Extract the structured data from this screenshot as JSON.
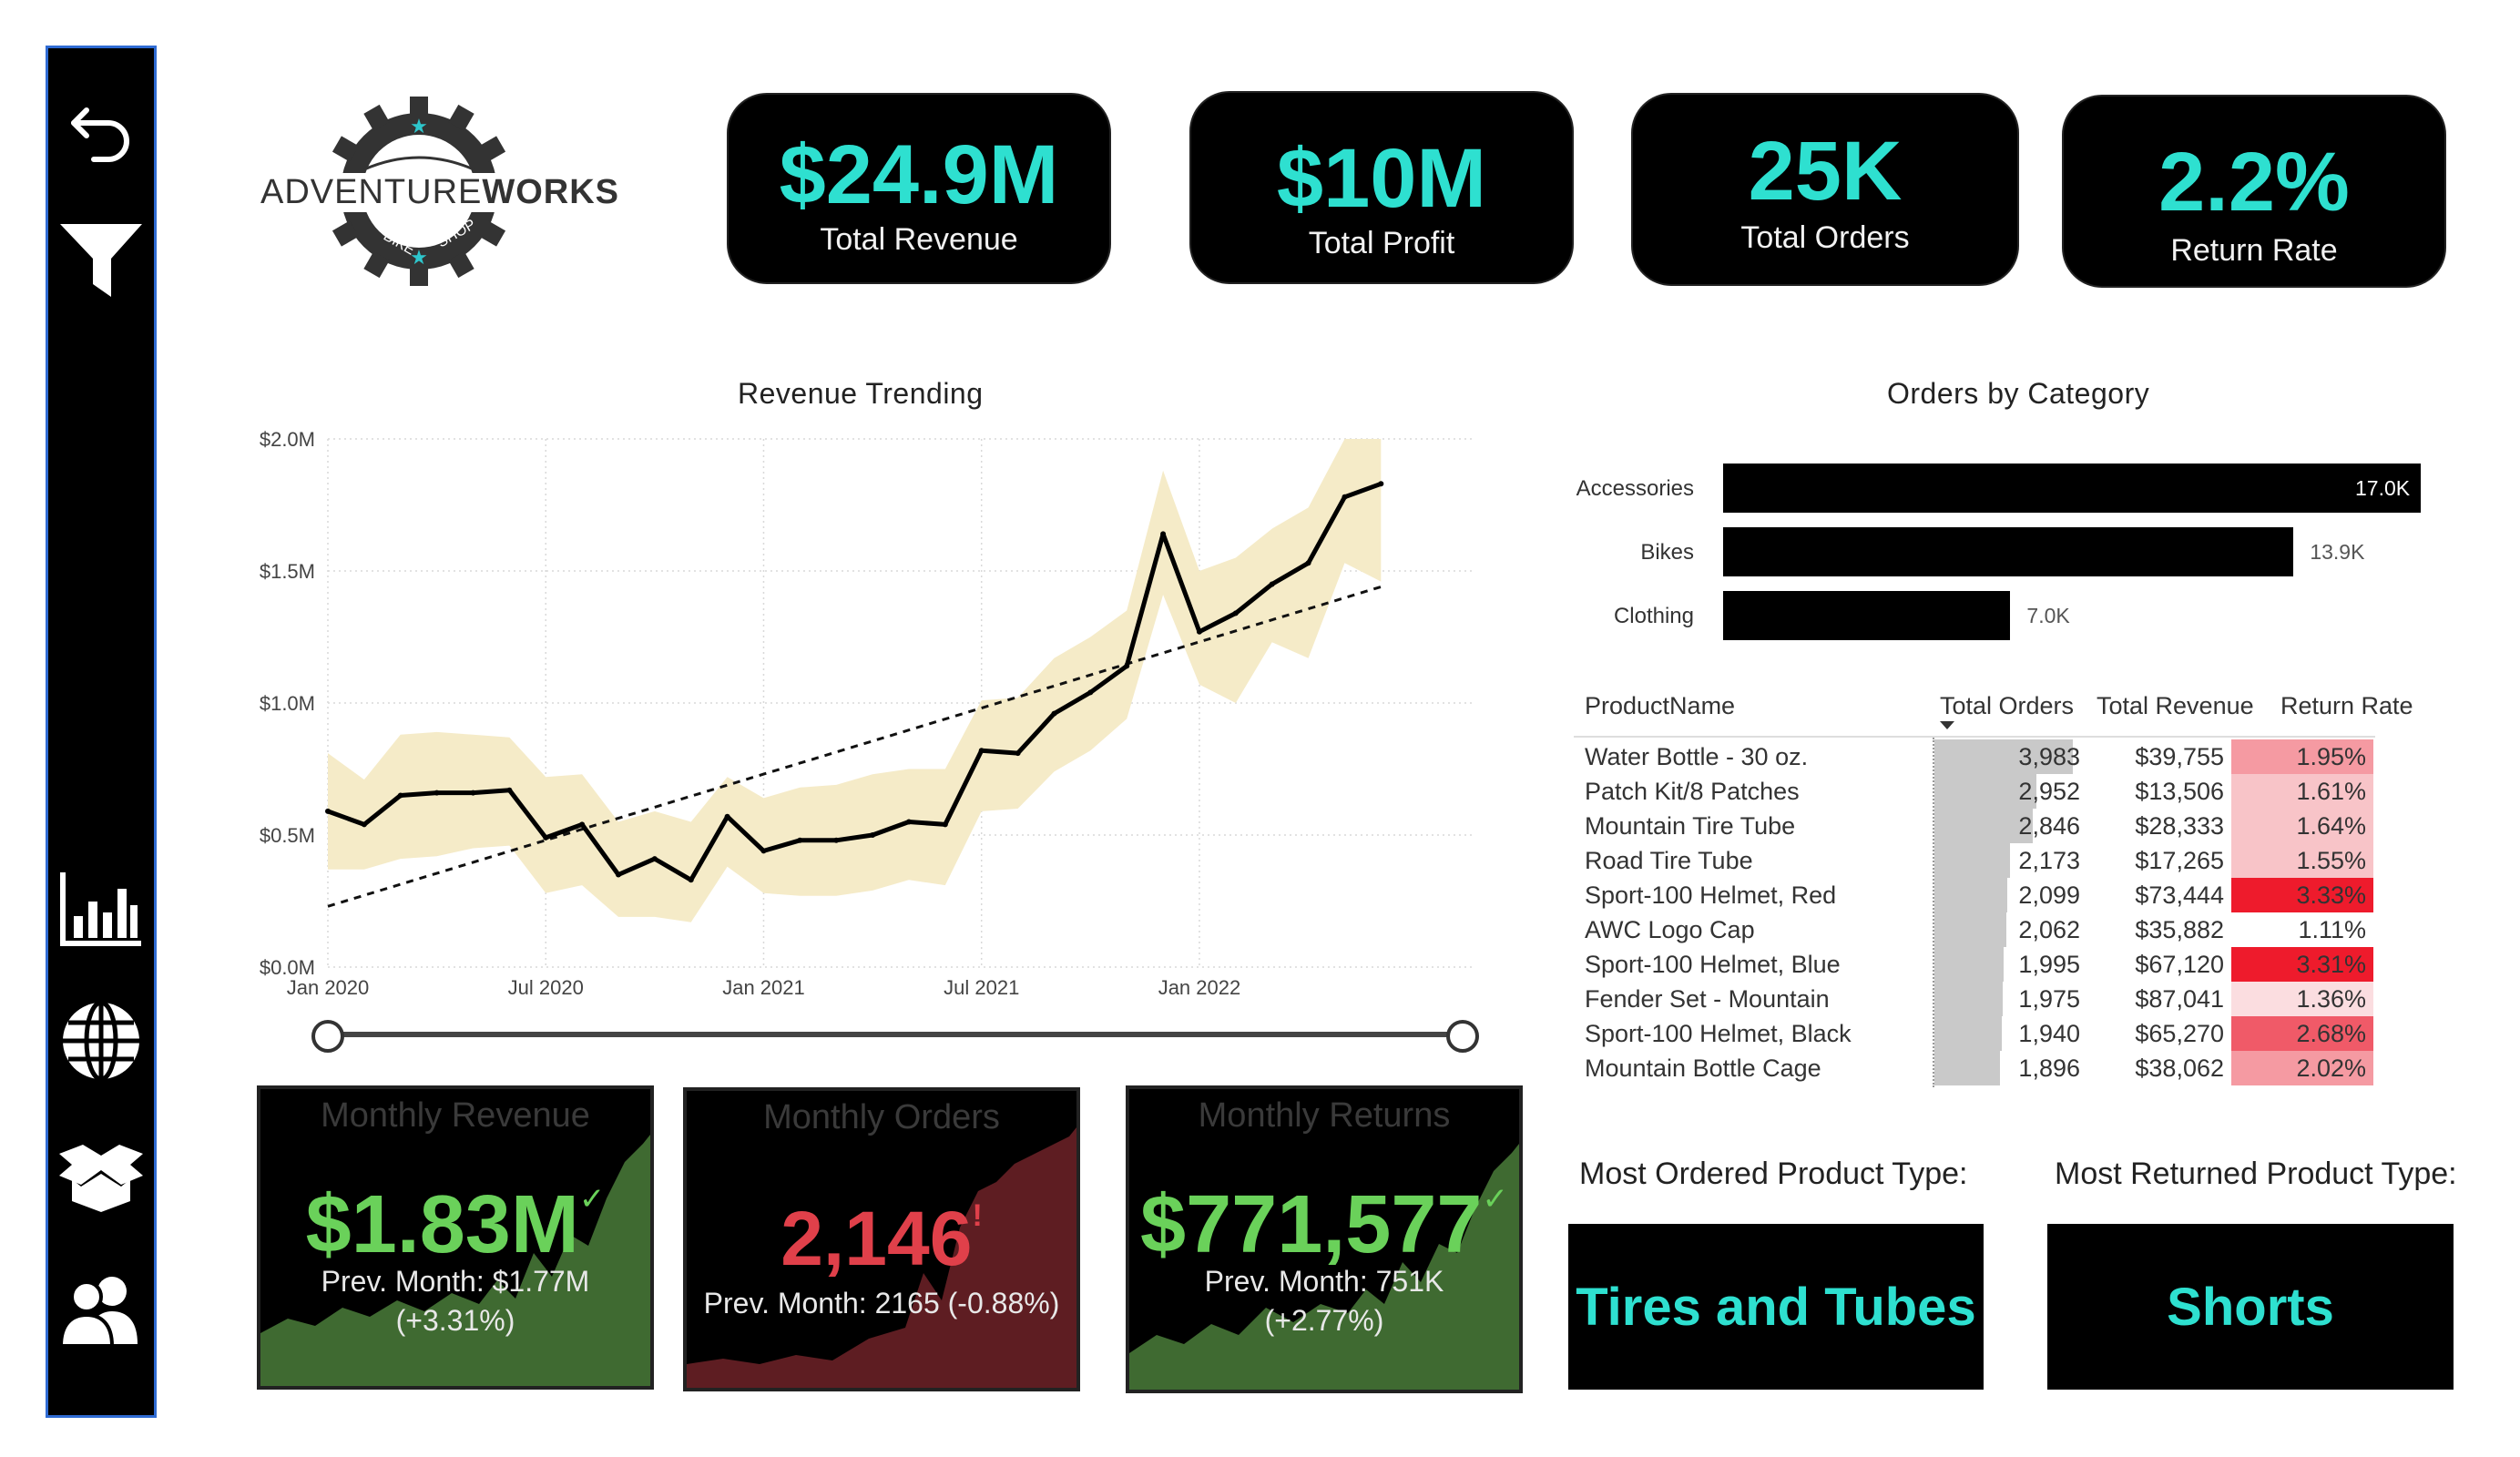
{
  "brand": {
    "logo_text_light": "ADVENTURE",
    "logo_text_bold": "WORKS",
    "logo_ring_text": "BIKE ★ SHOP"
  },
  "sidebar": {
    "items": [
      {
        "icon": "back-arrow-icon"
      },
      {
        "icon": "filter-icon"
      },
      {
        "icon": "bar-chart-icon"
      },
      {
        "icon": "globe-icon"
      },
      {
        "icon": "box-icon"
      },
      {
        "icon": "users-icon"
      }
    ]
  },
  "kpis": [
    {
      "value": "$24.9M",
      "label": "Total Revenue"
    },
    {
      "value": "$10M",
      "label": "Total Profit"
    },
    {
      "value": "25K",
      "label": "Total Orders"
    },
    {
      "value": "2.2%",
      "label": "Return Rate"
    }
  ],
  "revenue_title": "Revenue Trending",
  "orders_title": "Orders by Category",
  "chart_data": [
    {
      "type": "line",
      "title": "Revenue Trending",
      "x_ticks": [
        "Jan 2020",
        "Jul 2020",
        "Jan 2021",
        "Jul 2021",
        "Jan 2022"
      ],
      "y_ticks": [
        "$0.0M",
        "$0.5M",
        "$1.0M",
        "$1.5M",
        "$2.0M"
      ],
      "ylim": [
        0,
        2.0
      ],
      "x": [
        "2020-01",
        "2020-02",
        "2020-03",
        "2020-04",
        "2020-05",
        "2020-06",
        "2020-07",
        "2020-08",
        "2020-09",
        "2020-10",
        "2020-11",
        "2020-12",
        "2021-01",
        "2021-02",
        "2021-03",
        "2021-04",
        "2021-05",
        "2021-06",
        "2021-07",
        "2021-08",
        "2021-09",
        "2021-10",
        "2021-11",
        "2021-12",
        "2022-01",
        "2022-02",
        "2022-03",
        "2022-04",
        "2022-05",
        "2022-06"
      ],
      "series": [
        {
          "values": [
            0.59,
            0.54,
            0.65,
            0.66,
            0.66,
            0.67,
            0.49,
            0.54,
            0.35,
            0.41,
            0.33,
            0.57,
            0.44,
            0.48,
            0.48,
            0.5,
            0.55,
            0.54,
            0.82,
            0.81,
            0.96,
            1.04,
            1.14,
            1.64,
            1.27,
            1.34,
            1.45,
            1.53,
            1.78,
            1.83
          ]
        }
      ],
      "band_upper": [
        0.81,
        0.71,
        0.88,
        0.89,
        0.88,
        0.87,
        0.72,
        0.73,
        0.55,
        0.59,
        0.55,
        0.72,
        0.64,
        0.68,
        0.69,
        0.73,
        0.75,
        0.75,
        1.01,
        1.02,
        1.17,
        1.25,
        1.35,
        1.88,
        1.5,
        1.55,
        1.66,
        1.74,
        2.0,
        2.0
      ],
      "band_lower": [
        0.37,
        0.37,
        0.41,
        0.42,
        0.45,
        0.46,
        0.28,
        0.31,
        0.19,
        0.19,
        0.17,
        0.38,
        0.28,
        0.27,
        0.27,
        0.29,
        0.33,
        0.31,
        0.59,
        0.6,
        0.74,
        0.82,
        0.94,
        1.41,
        1.07,
        1.0,
        1.23,
        1.17,
        1.53,
        1.46
      ],
      "trend": [
        0.23,
        1.44
      ]
    },
    {
      "type": "bar",
      "title": "Orders by Category",
      "categories": [
        "Accessories",
        "Bikes",
        "Clothing"
      ],
      "values": [
        17.0,
        13.9,
        7.0
      ],
      "labels": [
        "17.0K",
        "13.9K",
        "7.0K"
      ]
    }
  ],
  "products": {
    "headers": [
      "ProductName",
      "Total Orders",
      "Total Revenue",
      "Return Rate"
    ],
    "rows": [
      {
        "name": "Water Bottle - 30 oz.",
        "orders": "3,983",
        "orders_n": 3983,
        "revenue": "$39,755",
        "rate": "1.95%",
        "rate_n": 1.95
      },
      {
        "name": "Patch Kit/8 Patches",
        "orders": "2,952",
        "orders_n": 2952,
        "revenue": "$13,506",
        "rate": "1.61%",
        "rate_n": 1.61
      },
      {
        "name": "Mountain Tire Tube",
        "orders": "2,846",
        "orders_n": 2846,
        "revenue": "$28,333",
        "rate": "1.64%",
        "rate_n": 1.64
      },
      {
        "name": "Road Tire Tube",
        "orders": "2,173",
        "orders_n": 2173,
        "revenue": "$17,265",
        "rate": "1.55%",
        "rate_n": 1.55
      },
      {
        "name": "Sport-100 Helmet, Red",
        "orders": "2,099",
        "orders_n": 2099,
        "revenue": "$73,444",
        "rate": "3.33%",
        "rate_n": 3.33
      },
      {
        "name": "AWC Logo Cap",
        "orders": "2,062",
        "orders_n": 2062,
        "revenue": "$35,882",
        "rate": "1.11%",
        "rate_n": 1.11
      },
      {
        "name": "Sport-100 Helmet, Blue",
        "orders": "1,995",
        "orders_n": 1995,
        "revenue": "$67,120",
        "rate": "3.31%",
        "rate_n": 3.31
      },
      {
        "name": "Fender Set - Mountain",
        "orders": "1,975",
        "orders_n": 1975,
        "revenue": "$87,041",
        "rate": "1.36%",
        "rate_n": 1.36
      },
      {
        "name": "Sport-100 Helmet, Black",
        "orders": "1,940",
        "orders_n": 1940,
        "revenue": "$65,270",
        "rate": "2.68%",
        "rate_n": 2.68
      },
      {
        "name": "Mountain Bottle Cage",
        "orders": "1,896",
        "orders_n": 1896,
        "revenue": "$38,062",
        "rate": "2.02%",
        "rate_n": 2.02
      }
    ]
  },
  "monthly": {
    "revenue": {
      "title": "Monthly Revenue",
      "value": "$1.83M",
      "mark": "✓",
      "prev": "Prev. Month: $1.77M",
      "delta": "(+3.31%)",
      "value_color": "#6ad15a"
    },
    "orders": {
      "title": "Monthly Orders",
      "value": "2,146",
      "mark": "!",
      "prev": "Prev. Month: 2165 (-0.88%)",
      "value_color": "#e0404a"
    },
    "returns": {
      "title": "Monthly Returns",
      "value": "$771,577",
      "mark": "✓",
      "prev": "Prev. Month: 751K",
      "delta": "(+2.77%)",
      "value_color": "#6ad15a"
    }
  },
  "most_ordered": {
    "label": "Most Ordered Product Type:",
    "value": "Tires and Tubes"
  },
  "most_returned": {
    "label": "Most Returned Product Type:",
    "value": "Shorts"
  }
}
